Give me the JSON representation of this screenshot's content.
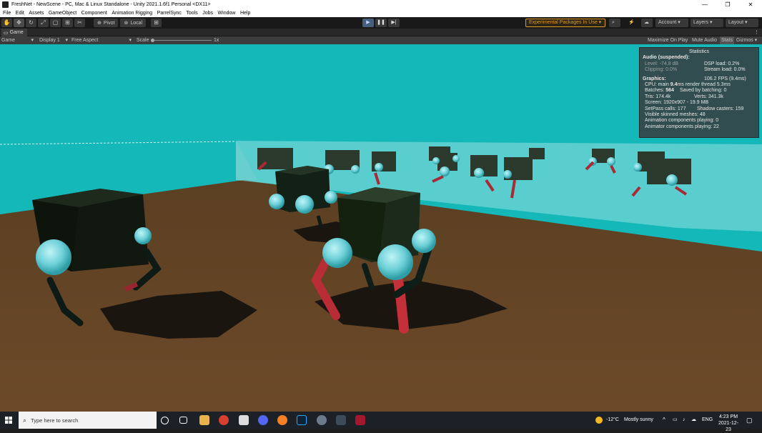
{
  "window": {
    "title": "FreshNet - NewScene - PC, Mac & Linux Standalone - Unity 2021.1.6f1 Personal <DX11>",
    "buttons": {
      "minimize": "—",
      "maximize": "❐",
      "close": "✕"
    }
  },
  "menu": [
    "File",
    "Edit",
    "Assets",
    "GameObject",
    "Component",
    "Animation Rigging",
    "ParrelSync",
    "Tools",
    "Jobs",
    "Window",
    "Help"
  ],
  "toolbar": {
    "pivot_label": "Pivot",
    "local_label": "Local",
    "experimental_label": "Experimental Packages In Use",
    "account_label": "Account",
    "layers_label": "Layers",
    "layout_label": "Layout"
  },
  "game_tab": {
    "label": "Game"
  },
  "game_bar": {
    "view_select": "Game",
    "display_select": "Display 1",
    "aspect_select": "Free Aspect",
    "scale_label": "Scale",
    "scale_value": "1x",
    "maximize_on_play": "Maximize On Play",
    "mute_audio": "Mute Audio",
    "stats": "Stats",
    "gizmos": "Gizmos"
  },
  "stats_panel": {
    "title": "Statistics",
    "audio_header": "Audio (suspended):",
    "level": "Level: -74.8 dB",
    "dsp_load": "DSP load: 0.2%",
    "clipping": "Clipping: 0.0%",
    "stream_load": "Stream load: 0.0%",
    "graphics_header": "Graphics:",
    "fps": "106.2 FPS (9.4ms)",
    "cpu_prefix": "CPU: main ",
    "cpu_main": "9.4",
    "cpu_suffix": "ms  render thread 5.3ms",
    "batches_prefix": "Batches: ",
    "batches": "564",
    "saved_by_batching": "Saved by batching: 0",
    "tris": "Tris: 174.4k",
    "verts": "Verts: 341.3k",
    "screen": "Screen: 1920x907 - 19.9 MB",
    "setpass": "SetPass calls: 177",
    "shadow_casters": "Shadow casters: 159",
    "skinned_meshes": "Visible skinned meshes: 48",
    "animation_components": "Animation components playing: 0",
    "animator_components": "Animator components playing: 22"
  },
  "taskbar": {
    "search_placeholder": "Type here to search",
    "weather_temp": "-12°C",
    "weather_desc": "Mostly sunny",
    "language": "ENG",
    "time": "4:23 PM",
    "date": "2021-12-23"
  },
  "colors": {
    "sky": "#14b8b8",
    "floor": "#6d4b2a",
    "robot_leg": "#b52a35",
    "robot_joint": "#7fd9e0",
    "experimental_accent": "#e09a1d"
  }
}
